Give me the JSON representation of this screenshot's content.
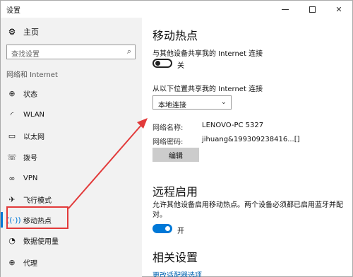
{
  "window": {
    "title": "设置",
    "controls": {
      "minimize": "",
      "maximize": "",
      "close": "✕"
    }
  },
  "sidebar": {
    "home_label": "主页",
    "search_placeholder": "查找设置",
    "section_label": "网络和 Internet",
    "items": [
      {
        "label": "状态",
        "icon": "globe-icon"
      },
      {
        "label": "WLAN",
        "icon": "wifi-icon"
      },
      {
        "label": "以太网",
        "icon": "ethernet-icon"
      },
      {
        "label": "拨号",
        "icon": "dialup-icon"
      },
      {
        "label": "VPN",
        "icon": "vpn-icon"
      },
      {
        "label": "飞行模式",
        "icon": "airplane-icon"
      },
      {
        "label": "移动热点",
        "icon": "hotspot-icon",
        "active": true
      },
      {
        "label": "数据使用量",
        "icon": "data-usage-icon"
      },
      {
        "label": "代理",
        "icon": "proxy-icon"
      }
    ]
  },
  "main": {
    "hotspot": {
      "title": "移动热点",
      "share_label": "与其他设备共享我的 Internet 连接",
      "share_toggle_state": "关",
      "source_label": "从以下位置共享我的 Internet 连接",
      "source_value": "本地连接",
      "network_name_key": "网络名称:",
      "network_name_value": "LENOVO-PC 5327",
      "network_password_key": "网络密码:",
      "network_password_value": "jihuang&199309238416...[]",
      "edit_button": "编辑"
    },
    "remote": {
      "title": "远程启用",
      "description": "允许其他设备启用移动热点。两个设备必须都已启用蓝牙并配对。",
      "toggle_state": "开"
    },
    "related": {
      "title": "相关设置",
      "link": "更改适配器选项"
    }
  },
  "colors": {
    "accent": "#0078d7",
    "annotation_red": "#e23a3a",
    "sidebar_bg": "#f2f2f2"
  }
}
